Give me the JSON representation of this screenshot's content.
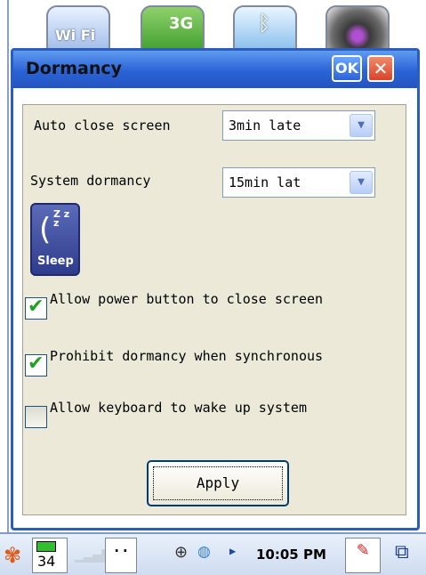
{
  "desktop": {
    "icons": [
      {
        "name": "wifi-icon",
        "label": "Wi Fi"
      },
      {
        "name": "3g-icon",
        "label": "3G"
      },
      {
        "name": "bluetooth-icon",
        "label": "ᛒ"
      },
      {
        "name": "camera-icon",
        "label": ""
      }
    ]
  },
  "dialog": {
    "title": "Dormancy",
    "ok_label": "OK",
    "close_label": "✕",
    "auto_close": {
      "label": "Auto close screen",
      "value": "3min late"
    },
    "system_dormancy": {
      "label": "System dormancy",
      "value": "15min lat"
    },
    "sleep_icon": {
      "label": "Sleep",
      "zz": "Z z z"
    },
    "checkboxes": [
      {
        "label": "Allow power button to close screen",
        "checked": true
      },
      {
        "label": "Prohibit dormancy when synchronous",
        "checked": true
      },
      {
        "label": "Allow keyboard to wake up system",
        "checked": false
      }
    ],
    "apply_label": "Apply"
  },
  "taskbar": {
    "battery_level": "34",
    "dots": "..",
    "time": "10:05 PM"
  },
  "colors": {
    "titlebar": "#2a63d6",
    "check": "#21a121",
    "panel": "#ece9d8"
  }
}
